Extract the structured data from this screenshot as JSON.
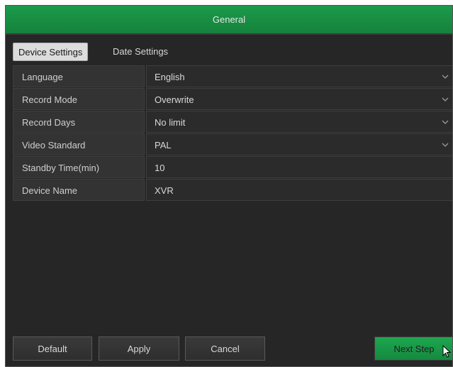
{
  "window": {
    "title": "General"
  },
  "tabs": [
    {
      "label": "Device Settings",
      "active": true
    },
    {
      "label": "Date Settings",
      "active": false
    }
  ],
  "settings": [
    {
      "label": "Language",
      "value": "English",
      "dropdown": true
    },
    {
      "label": "Record Mode",
      "value": "Overwrite",
      "dropdown": true
    },
    {
      "label": "Record Days",
      "value": "No limit",
      "dropdown": true
    },
    {
      "label": "Video Standard",
      "value": "PAL",
      "dropdown": true
    },
    {
      "label": "Standby Time(min)",
      "value": "10",
      "dropdown": false
    },
    {
      "label": "Device Name",
      "value": "XVR",
      "dropdown": false
    }
  ],
  "buttons": {
    "default": "Default",
    "apply": "Apply",
    "cancel": "Cancel",
    "next": "Next Step"
  },
  "colors": {
    "titlebar": "#1c9a4a",
    "panel_bg": "#262626",
    "next_button": "#1da74f",
    "active_tab": "#dcdcdc"
  },
  "icons": {
    "dropdown": "chevron-down-icon",
    "cursor": "mouse-pointer-icon"
  }
}
